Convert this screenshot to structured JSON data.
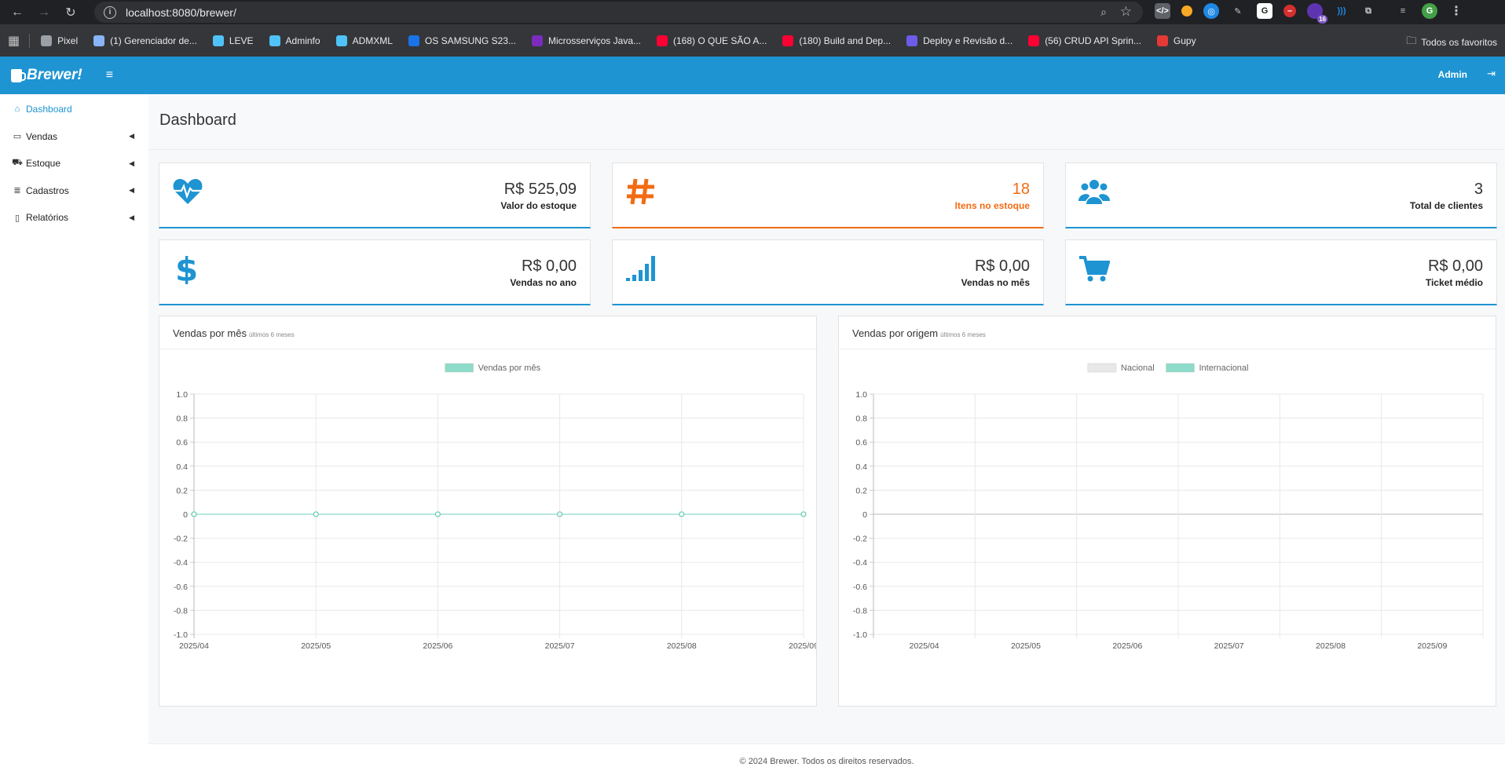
{
  "browser": {
    "url": "localhost:8080/brewer/",
    "bookmarks": [
      {
        "label": "Pixel",
        "color": "#9aa0a6"
      },
      {
        "label": "(1) Gerenciador de...",
        "color": "#8ab4f8"
      },
      {
        "label": "LEVE",
        "color": "#4fc3f7"
      },
      {
        "label": "Adminfo",
        "color": "#4fc3f7"
      },
      {
        "label": "ADMXML",
        "color": "#4fc3f7"
      },
      {
        "label": "OS SAMSUNG S23...",
        "color": "#1a73e8"
      },
      {
        "label": "Microsserviços Java...",
        "color": "#7b2cbf"
      },
      {
        "label": "(168) O QUE SÃO A...",
        "color": "#ff0033"
      },
      {
        "label": "(180) Build and Dep...",
        "color": "#ff0033"
      },
      {
        "label": "Deploy e Revisão d...",
        "color": "#6c5ce7"
      },
      {
        "label": "(56) CRUD API Sprin...",
        "color": "#ff0033"
      },
      {
        "label": "Gupy",
        "color": "#e53935"
      }
    ],
    "all_bookmarks": "Todos os favoritos",
    "ext_badge": "16",
    "profile_initial": "G"
  },
  "app": {
    "brand": "Brewer!",
    "user": "Admin"
  },
  "sidebar": {
    "items": [
      {
        "label": "Dashboard",
        "icon": "home-icon"
      },
      {
        "label": "Vendas",
        "icon": "credit-card-icon"
      },
      {
        "label": "Estoque",
        "icon": "truck-icon"
      },
      {
        "label": "Cadastros",
        "icon": "database-icon"
      },
      {
        "label": "Relatórios",
        "icon": "file-icon"
      }
    ]
  },
  "page": {
    "title": "Dashboard"
  },
  "cards": [
    {
      "value": "R$ 525,09",
      "label": "Valor do estoque",
      "icon": "heartbeat-icon",
      "color": "#1e94d2"
    },
    {
      "value": "18",
      "label": "Itens no estoque",
      "icon": "hashtag-icon",
      "color": "#f26b13"
    },
    {
      "value": "3",
      "label": "Total de clientes",
      "icon": "users-icon",
      "color": "#1e94d2"
    },
    {
      "value": "R$ 0,00",
      "label": "Vendas no ano",
      "icon": "dollar-icon",
      "color": "#1e94d2"
    },
    {
      "value": "R$ 0,00",
      "label": "Vendas no mês",
      "icon": "signal-icon",
      "color": "#1e94d2"
    },
    {
      "value": "R$ 0,00",
      "label": "Ticket médio",
      "icon": "cart-icon",
      "color": "#1e94d2"
    }
  ],
  "panels": [
    {
      "title": "Vendas por mês",
      "subtitle": "últimos 6 meses"
    },
    {
      "title": "Vendas por origem",
      "subtitle": "últimos 6 meses"
    }
  ],
  "chart_data": [
    {
      "type": "line",
      "title": "",
      "categories": [
        "2025/04",
        "2025/05",
        "2025/06",
        "2025/07",
        "2025/08",
        "2025/09"
      ],
      "series": [
        {
          "name": "Vendas por mês",
          "values": [
            0,
            0,
            0,
            0,
            0,
            0
          ],
          "color": "#8ddbc9"
        }
      ],
      "yticks": [
        "1.0",
        "0.8",
        "0.6",
        "0.4",
        "0.2",
        "0",
        "-0.2",
        "-0.4",
        "-0.6",
        "-0.8",
        "-1.0"
      ],
      "ylim": [
        -1.0,
        1.0
      ],
      "grid": true,
      "legend": "top-center"
    },
    {
      "type": "bar",
      "title": "",
      "categories": [
        "2025/04",
        "2025/05",
        "2025/06",
        "2025/07",
        "2025/08",
        "2025/09"
      ],
      "series": [
        {
          "name": "Nacional",
          "values": [
            0,
            0,
            0,
            0,
            0,
            0
          ],
          "color": "#e8e8e8"
        },
        {
          "name": "Internacional",
          "values": [
            0,
            0,
            0,
            0,
            0,
            0
          ],
          "color": "#8ddbc9"
        }
      ],
      "yticks": [
        "1.0",
        "0.8",
        "0.6",
        "0.4",
        "0.2",
        "0",
        "-0.2",
        "-0.4",
        "-0.6",
        "-0.8",
        "-1.0"
      ],
      "ylim": [
        -1.0,
        1.0
      ],
      "grid": true,
      "legend": "top-center"
    }
  ],
  "footer": {
    "text": "© 2024 Brewer. Todos os direitos reservados."
  }
}
